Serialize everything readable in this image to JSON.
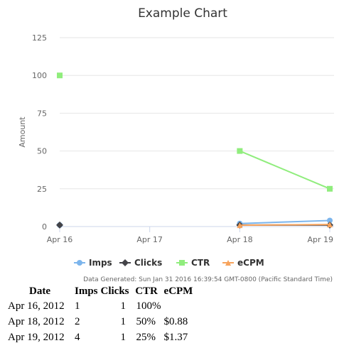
{
  "chart_data": {
    "type": "line",
    "title": "Example Chart",
    "ylabel": "Amount",
    "xlabel": "",
    "categories": [
      "Apr 16",
      "Apr 17",
      "Apr 18",
      "Apr 19"
    ],
    "ylim": [
      0,
      125
    ],
    "yticks": [
      0,
      25,
      50,
      75,
      100,
      125
    ],
    "grid": true,
    "legend_position": "bottom",
    "series": [
      {
        "name": "Imps",
        "color": "#7cb5ec",
        "marker": "circle",
        "x": [
          "Apr 16",
          "Apr 18",
          "Apr 19"
        ],
        "values": [
          1,
          2,
          4
        ]
      },
      {
        "name": "Clicks",
        "color": "#434348",
        "marker": "diamond",
        "x": [
          "Apr 16",
          "Apr 18",
          "Apr 19"
        ],
        "values": [
          1,
          1,
          1
        ]
      },
      {
        "name": "CTR",
        "color": "#90ed7d",
        "marker": "square",
        "x": [
          "Apr 16",
          "Apr 18",
          "Apr 19"
        ],
        "values": [
          100,
          50,
          25
        ]
      },
      {
        "name": "eCPM",
        "color": "#f7a35c",
        "marker": "triangle",
        "x": [
          "Apr 18",
          "Apr 19"
        ],
        "values": [
          0.88,
          1.37
        ]
      }
    ],
    "caption": "Data Generated: Sun Jan 31 2016 16:39:54 GMT-0800 (Pacific Standard Time)"
  },
  "table": {
    "headers": [
      "Date",
      "Imps",
      "Clicks",
      "CTR",
      "eCPM"
    ],
    "rows": [
      [
        "Apr 16, 2012",
        "1",
        "1",
        "100%",
        ""
      ],
      [
        "Apr 18, 2012",
        "2",
        "1",
        "50%",
        "$0.88"
      ],
      [
        "Apr 19, 2012",
        "4",
        "1",
        "25%",
        "$1.37"
      ]
    ]
  }
}
